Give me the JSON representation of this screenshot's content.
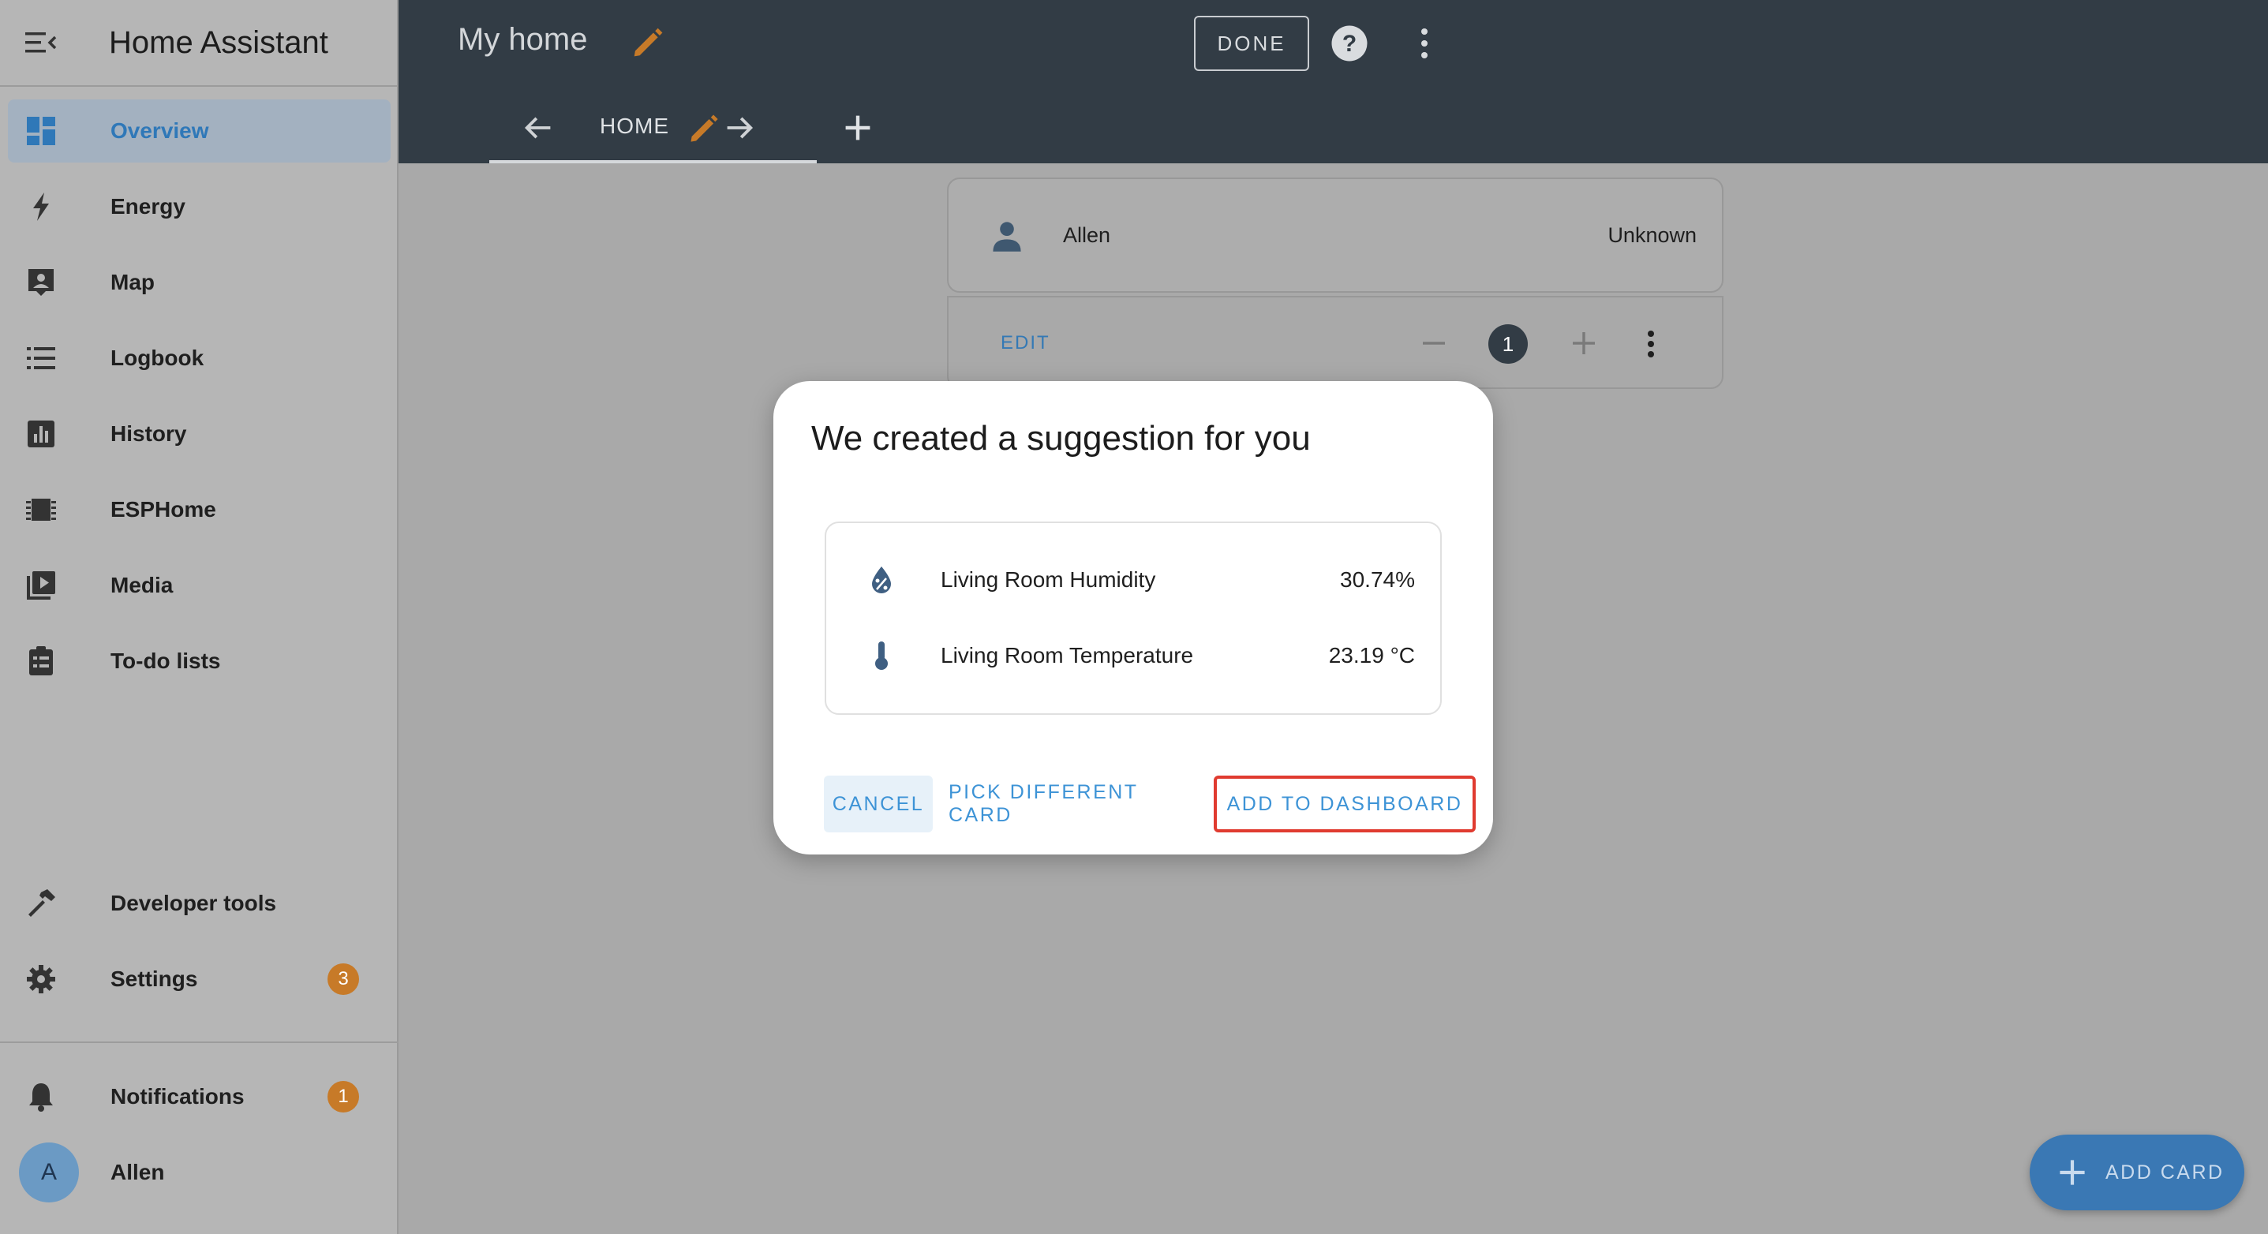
{
  "sidebar": {
    "app_title": "Home Assistant",
    "items": [
      {
        "label": "Overview",
        "icon": "dashboard-icon",
        "active": true
      },
      {
        "label": "Energy",
        "icon": "lightning-icon"
      },
      {
        "label": "Map",
        "icon": "map-account-icon"
      },
      {
        "label": "Logbook",
        "icon": "logbook-list-icon"
      },
      {
        "label": "History",
        "icon": "history-chart-icon"
      },
      {
        "label": "ESPHome",
        "icon": "chip-icon"
      },
      {
        "label": "Media",
        "icon": "media-play-icon"
      },
      {
        "label": "To-do lists",
        "icon": "clipboard-list-icon"
      }
    ],
    "developer_tools": "Developer tools",
    "settings": "Settings",
    "settings_badge": "3",
    "notifications": "Notifications",
    "notifications_badge": "1",
    "user_initial": "A",
    "user_name": "Allen"
  },
  "topbar": {
    "title": "My home",
    "done_label": "DONE",
    "tab_label": "HOME"
  },
  "card": {
    "name": "Allen",
    "state": "Unknown",
    "edit_label": "EDIT",
    "position": "1"
  },
  "dialog": {
    "title": "We created a suggestion for you",
    "entities": [
      {
        "name": "Living Room Humidity",
        "value": "30.74%",
        "icon": "water-percent-icon"
      },
      {
        "name": "Living Room Temperature",
        "value": "23.19 °C",
        "icon": "thermometer-icon"
      }
    ],
    "cancel_label": "CANCEL",
    "pick_label": "PICK DIFFERENT CARD",
    "add_label": "ADD TO DASHBOARD"
  },
  "fab": {
    "label": "ADD CARD"
  },
  "colors": {
    "accent": "#3d93d6",
    "header": "#323c45",
    "badge": "#c77a28",
    "highlight": "#e03b30"
  }
}
